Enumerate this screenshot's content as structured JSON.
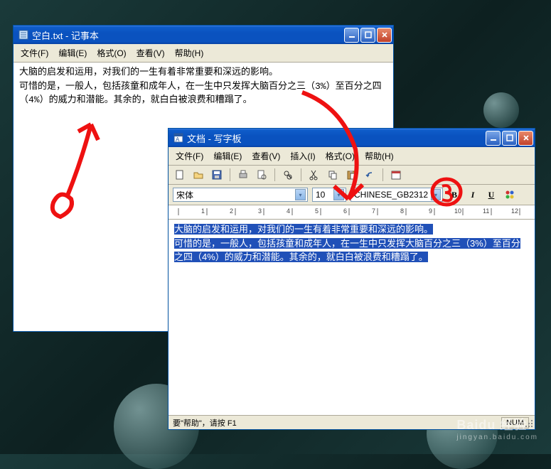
{
  "notepad": {
    "title": "空白.txt - 记事本",
    "menu": {
      "file": "文件(F)",
      "edit": "编辑(E)",
      "format": "格式(O)",
      "view": "查看(V)",
      "help": "帮助(H)"
    },
    "lines": [
      "大脑的启发和运用，对我们的一生有着非常重要和深远的影响。",
      "可惜的是，一般人，包括孩童和成年人，在一生中只发挥大脑百分之三（3%）至百分之四（4%）的威力和潜能。其余的，就白白被浪费和糟蹋了。"
    ]
  },
  "wordpad": {
    "title": "文档 - 写字板",
    "menu": {
      "file": "文件(F)",
      "edit": "编辑(E)",
      "view": "查看(V)",
      "insert": "插入(I)",
      "format": "格式(O)",
      "help": "帮助(H)"
    },
    "font_name": "宋体",
    "font_size": "10",
    "charset": "CHINESE_GB2312",
    "ruler_marks": [
      "1",
      "2",
      "3",
      "4",
      "5",
      "6",
      "7",
      "8",
      "9",
      "10",
      "11",
      "12"
    ],
    "lines": [
      "大脑的启发和运用，对我们的一生有着非常重要和深远的影响。",
      "可惜的是，一般人，包括孩童和成年人，在一生中只发挥大脑百分之三（3%）至百分之四（4%）的威力和潜能。其余的，就白白被浪费和糟蹋了。"
    ],
    "status_help": "要\"帮助\"，请按 F1",
    "status_num": "NUM"
  },
  "watermark": {
    "brand": "Baidu 经验",
    "url": "jingyan.baidu.com"
  }
}
